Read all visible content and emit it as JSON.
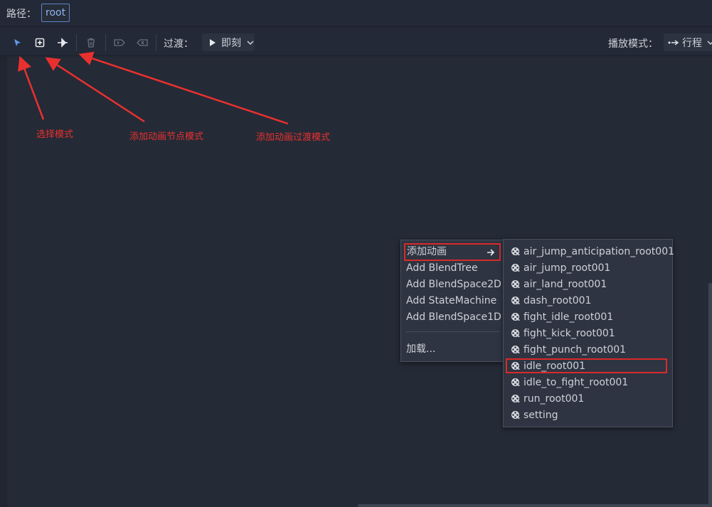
{
  "path": {
    "label": "路径：",
    "value": "root"
  },
  "toolbar": {
    "transition_label": "过渡：",
    "transition_value": "即刻",
    "play_mode_label": "播放模式：",
    "play_mode_value": "行程"
  },
  "annotations": {
    "select_mode": "选择模式",
    "add_node_mode": "添加动画节点模式",
    "add_transition_mode": "添加动画过渡模式",
    "color": "#e8312f"
  },
  "context_menu": {
    "items": [
      "添加动画",
      "Add BlendTree",
      "Add BlendSpace2D",
      "Add StateMachine",
      "Add BlendSpace1D"
    ],
    "load": "加载..."
  },
  "submenu": {
    "items": [
      "air_jump_anticipation_root001",
      "air_jump_root001",
      "air_land_root001",
      "dash_root001",
      "fight_idle_root001",
      "fight_kick_root001",
      "fight_punch_root001",
      "idle_root001",
      "idle_to_fight_root001",
      "run_root001",
      "setting"
    ],
    "highlighted": "idle_root001"
  },
  "colors": {
    "accent": "#5c86c6",
    "highlight_border": "#d92a2a",
    "background": "#20252f"
  }
}
